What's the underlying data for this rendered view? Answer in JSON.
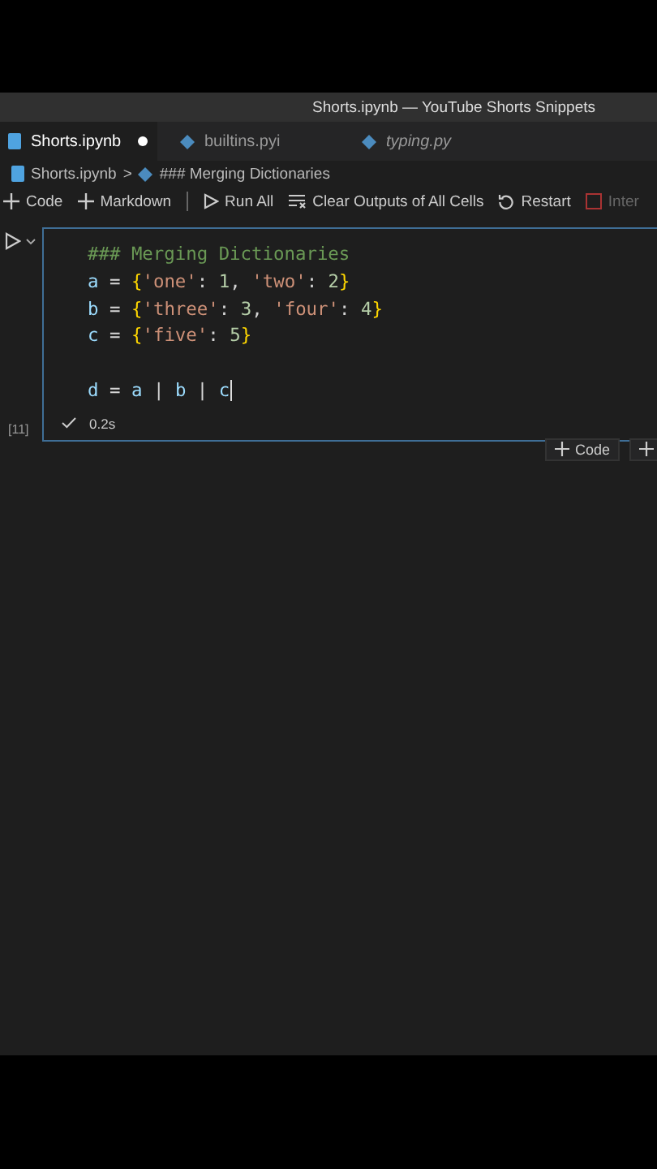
{
  "window": {
    "title": "Shorts.ipynb — YouTube Shorts Snippets"
  },
  "tabs": [
    {
      "label": "Shorts.ipynb",
      "kind": "notebook",
      "selected": true,
      "modified": true,
      "preview": false
    },
    {
      "label": "builtins.pyi",
      "kind": "python",
      "selected": false,
      "modified": false,
      "preview": false
    },
    {
      "label": "typing.py",
      "kind": "python",
      "selected": false,
      "modified": false,
      "preview": true
    }
  ],
  "breadcrumb": [
    {
      "label": "Shorts.ipynb",
      "kind": "notebook"
    },
    {
      "label": "### Merging Dictionaries",
      "kind": "python"
    }
  ],
  "breadcrumb_separator": ">",
  "toolbar": [
    {
      "label": "Code",
      "kind": "add"
    },
    {
      "label": "Markdown",
      "kind": "add"
    },
    {
      "kind": "separator"
    },
    {
      "label": "Run All",
      "kind": "run"
    },
    {
      "label": "Clear Outputs of All Cells",
      "kind": "clear"
    },
    {
      "label": "Restart",
      "kind": "restart"
    },
    {
      "label": "Inter",
      "kind": "interrupt",
      "disabled": true
    }
  ],
  "cell": {
    "execution_count": "[11]",
    "status": "0.2s",
    "succeeded": true,
    "focused": true,
    "lines": [
      {
        "kind": "code",
        "tokens": [
          {
            "text": "### Merging Dictionaries",
            "kind": "comment"
          }
        ]
      },
      {
        "kind": "code",
        "tokens": [
          {
            "text": "a",
            "kind": "var"
          },
          {
            "text": " = ",
            "kind": "op"
          },
          {
            "text": "{",
            "kind": "brace"
          },
          {
            "text": "'one'",
            "kind": "string"
          },
          {
            "text": ": ",
            "kind": "op"
          },
          {
            "text": "1",
            "kind": "number"
          },
          {
            "text": ", ",
            "kind": "op"
          },
          {
            "text": "'two'",
            "kind": "string"
          },
          {
            "text": ": ",
            "kind": "op"
          },
          {
            "text": "2",
            "kind": "number"
          },
          {
            "text": "}",
            "kind": "brace"
          }
        ]
      },
      {
        "kind": "code",
        "tokens": [
          {
            "text": "b",
            "kind": "var"
          },
          {
            "text": " = ",
            "kind": "op"
          },
          {
            "text": "{",
            "kind": "brace"
          },
          {
            "text": "'three'",
            "kind": "string"
          },
          {
            "text": ": ",
            "kind": "op"
          },
          {
            "text": "3",
            "kind": "number"
          },
          {
            "text": ", ",
            "kind": "op"
          },
          {
            "text": "'four'",
            "kind": "string"
          },
          {
            "text": ": ",
            "kind": "op"
          },
          {
            "text": "4",
            "kind": "number"
          },
          {
            "text": "}",
            "kind": "brace"
          }
        ]
      },
      {
        "kind": "code",
        "tokens": [
          {
            "text": "c",
            "kind": "var"
          },
          {
            "text": " = ",
            "kind": "op"
          },
          {
            "text": "{",
            "kind": "brace"
          },
          {
            "text": "'five'",
            "kind": "string"
          },
          {
            "text": ": ",
            "kind": "op"
          },
          {
            "text": "5",
            "kind": "number"
          },
          {
            "text": "}",
            "kind": "brace"
          }
        ]
      },
      {
        "kind": "blank"
      },
      {
        "kind": "code",
        "cursor": true,
        "tokens": [
          {
            "text": "d",
            "kind": "var"
          },
          {
            "text": " = ",
            "kind": "op"
          },
          {
            "text": "a",
            "kind": "var"
          },
          {
            "text": " | ",
            "kind": "op"
          },
          {
            "text": "b",
            "kind": "var"
          },
          {
            "text": " | ",
            "kind": "op"
          },
          {
            "text": "c",
            "kind": "var"
          }
        ]
      }
    ]
  },
  "add_cell_button": {
    "label": "Code"
  }
}
